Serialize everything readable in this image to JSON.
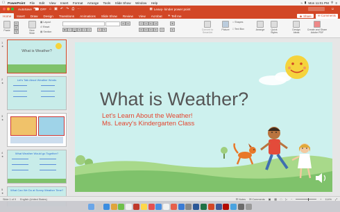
{
  "menubar": {
    "app": "PowerPoint",
    "items": [
      "File",
      "Edit",
      "View",
      "Insert",
      "Format",
      "Arrange",
      "Tools",
      "Slide Show",
      "Window",
      "Help"
    ],
    "clock": "Mon 11:01 PM"
  },
  "titlebar": {
    "autosave_label": "AutoSave",
    "autosave_state": "OFF",
    "doc_title": "Leavy- kinder power point"
  },
  "tabs": [
    "Home",
    "Insert",
    "Draw",
    "Design",
    "Transitions",
    "Animations",
    "Slide Show",
    "Review",
    "View",
    "Acrobat",
    "Tell me"
  ],
  "share_label": "Share",
  "comments_label": "Comments",
  "ribbon": {
    "paste": "Paste",
    "new_slide": "New Slide",
    "layout": "Layout",
    "reset": "Reset",
    "section": "Section",
    "convert_smartart": "Convert to SmartArt",
    "picture": "Picture",
    "shapes": "Shapes",
    "text_box": "Text Box",
    "arrange": "Arrange",
    "quick_styles": "Quick Styles",
    "design_ideas": "Design Ideas",
    "create_share_pdf": "Create and Share Adobe PDF"
  },
  "thumbnails": [
    {
      "num": "1",
      "title": "What is Weather?"
    },
    {
      "num": "2",
      "title": "Let's Talk About Weather Words"
    },
    {
      "num": "3",
      "title": ""
    },
    {
      "num": "4",
      "title": "What Weather Would go Together?"
    },
    {
      "num": "5",
      "title": "What Can We Do at Sunny Weather Time?"
    }
  ],
  "slide": {
    "title": "What is Weather?",
    "subtitle1": "Let's Learn About the Weather!",
    "subtitle2": "Ms. Leavy's Kindergarten Class"
  },
  "status": {
    "slide_of": "Slide 1 of 9",
    "language": "English (United States)",
    "notes": "Notes",
    "comments": "Comments",
    "zoom": "114%"
  },
  "colors": {
    "accent": "#d24726",
    "slide_bg": "#cdf1ee",
    "subtitle": "#e3452f",
    "grass": "#7fc26b"
  }
}
